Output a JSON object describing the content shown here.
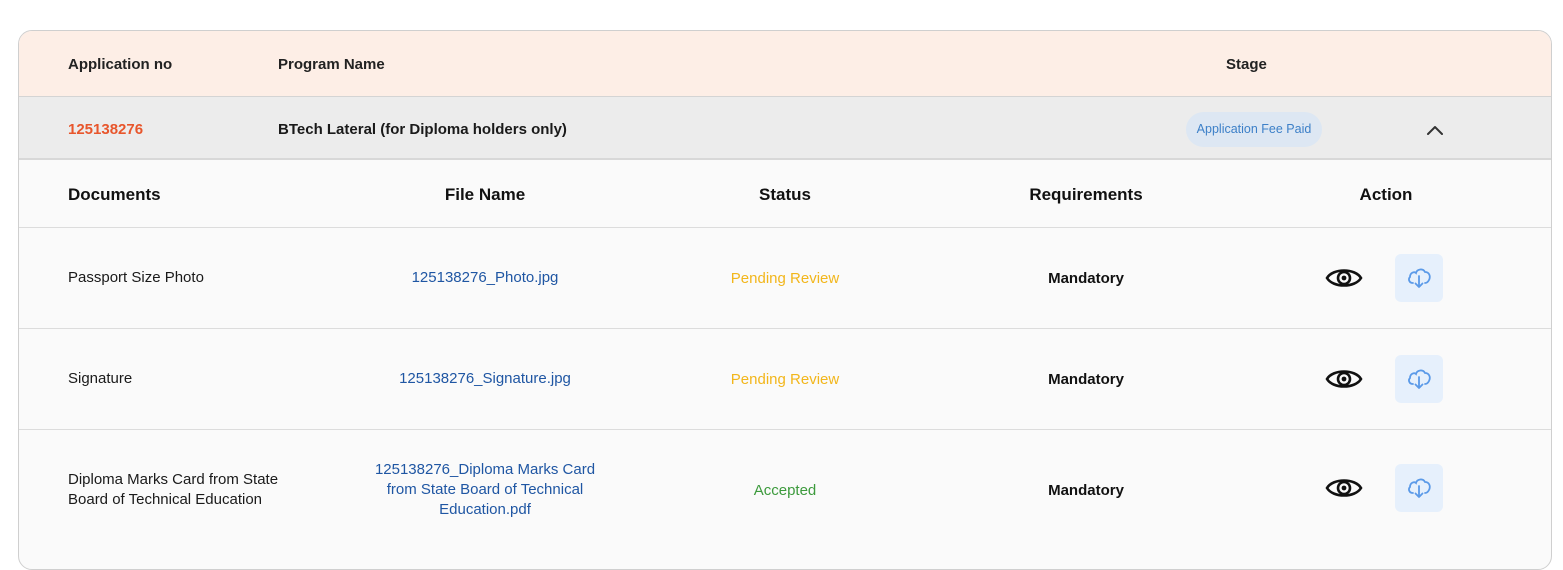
{
  "header": {
    "application_no_label": "Application no",
    "program_name_label": "Program Name",
    "stage_label": "Stage"
  },
  "application": {
    "number": "125138276",
    "program": "BTech Lateral (for Diploma holders only)",
    "stage": "Application Fee Paid"
  },
  "documents_table": {
    "columns": [
      "Documents",
      "File Name",
      "Status",
      "Requirements",
      "Action"
    ],
    "rows": [
      {
        "document": "Passport Size Photo",
        "file_name": "125138276_Photo.jpg",
        "status": "Pending Review",
        "requirement": "Mandatory"
      },
      {
        "document": "Signature",
        "file_name": "125138276_Signature.jpg",
        "status": "Pending Review",
        "requirement": "Mandatory"
      },
      {
        "document": "Diploma Marks Card from State Board of Technical Education",
        "file_name": "125138276_Diploma Marks Card from State Board of Technical Education.pdf",
        "status": "Accepted",
        "requirement": "Mandatory"
      }
    ]
  },
  "icons": {
    "view": "eye-icon",
    "download": "cloud-download-icon",
    "collapse": "chevron-up-icon"
  },
  "colors": {
    "application_number": "#e8562c",
    "header_background": "#fdeee6",
    "stage_badge_bg": "#dde7f3",
    "stage_badge_text": "#3d80c8",
    "file_link": "#1f56a3",
    "status_pending": "#f2b61b",
    "status_accepted": "#3c9a3c",
    "download_button_bg": "#e6f0fc"
  }
}
